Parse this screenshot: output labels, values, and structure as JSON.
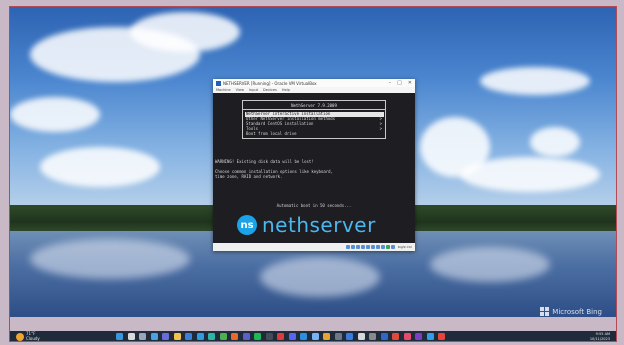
{
  "vm_window": {
    "title": "NETHSERVER [Running] - Oracle VM VirtualBox",
    "menu": [
      "Machine",
      "View",
      "Input",
      "Devices",
      "Help"
    ],
    "controls": [
      "–",
      "□",
      "✕"
    ],
    "host_key": "Right Ctrl"
  },
  "installer": {
    "version_title": "NethServer 7.9.2009",
    "menu_items": [
      {
        "label": "NethServer interactive installation",
        "arrow": "",
        "selected": true
      },
      {
        "label": "Other NethServer installation methods",
        "arrow": ">",
        "selected": false
      },
      {
        "label": "Standard CentOS installation",
        "arrow": ">",
        "selected": false
      },
      {
        "label": "Tools",
        "arrow": ">",
        "selected": false
      },
      {
        "label": "Boot from local drive",
        "arrow": "",
        "selected": false
      }
    ],
    "warning": "WARNING! Existing disk data will be lost!",
    "help_line1": "Choose common installation options like keyboard,",
    "help_line2": "time zone, RAID and network.",
    "autoboot": "Automatic boot in 50 seconds...",
    "logo_badge": "ns",
    "logo_word": "nethserver"
  },
  "desktop": {
    "watermark": "Microsoft Bing",
    "weather_temp": "71°F",
    "weather_desc": "Cloudy",
    "clock_time": "9:55 AM",
    "clock_date": "10/11/2023"
  },
  "taskbar": {
    "icons": [
      {
        "name": "windows-start-icon",
        "color": "#3a96dd"
      },
      {
        "name": "search-icon",
        "color": "#d9d9d9"
      },
      {
        "name": "task-view-icon",
        "color": "#9aa5b5"
      },
      {
        "name": "widgets-icon",
        "color": "#4aa3e0"
      },
      {
        "name": "chat-icon",
        "color": "#6b6bd6"
      },
      {
        "name": "file-explorer-icon",
        "color": "#f3c34b"
      },
      {
        "name": "store-icon",
        "color": "#3c7fd8"
      },
      {
        "name": "photos-icon",
        "color": "#2f9be0"
      },
      {
        "name": "edge-icon",
        "color": "#2fb6a2"
      },
      {
        "name": "chrome-icon",
        "color": "#4caf50"
      },
      {
        "name": "firefox-icon",
        "color": "#e86a2a"
      },
      {
        "name": "teams-icon",
        "color": "#5b5fc7"
      },
      {
        "name": "spotify-icon",
        "color": "#1db954"
      },
      {
        "name": "terminal-icon",
        "color": "#444c58"
      },
      {
        "name": "opera-icon",
        "color": "#e23a3a"
      },
      {
        "name": "discord-icon",
        "color": "#5865f2"
      },
      {
        "name": "vscode-icon",
        "color": "#2b8fe0"
      },
      {
        "name": "notepad-icon",
        "color": "#7ab4f0"
      },
      {
        "name": "paint-icon",
        "color": "#e5a330"
      },
      {
        "name": "calculator-icon",
        "color": "#6d7787"
      },
      {
        "name": "mail-icon",
        "color": "#3a7be0"
      },
      {
        "name": "security-icon",
        "color": "#d8d8d8"
      },
      {
        "name": "settings-icon",
        "color": "#8a8a8a"
      },
      {
        "name": "virtualbox-icon",
        "color": "#2f68c5"
      },
      {
        "name": "office-icon",
        "color": "#e04a3a"
      },
      {
        "name": "camera-icon",
        "color": "#e84a6a"
      },
      {
        "name": "onenote-icon",
        "color": "#7b3fc4"
      },
      {
        "name": "skype-icon",
        "color": "#2fa0e8"
      },
      {
        "name": "app-icon",
        "color": "#e8443a"
      }
    ]
  }
}
